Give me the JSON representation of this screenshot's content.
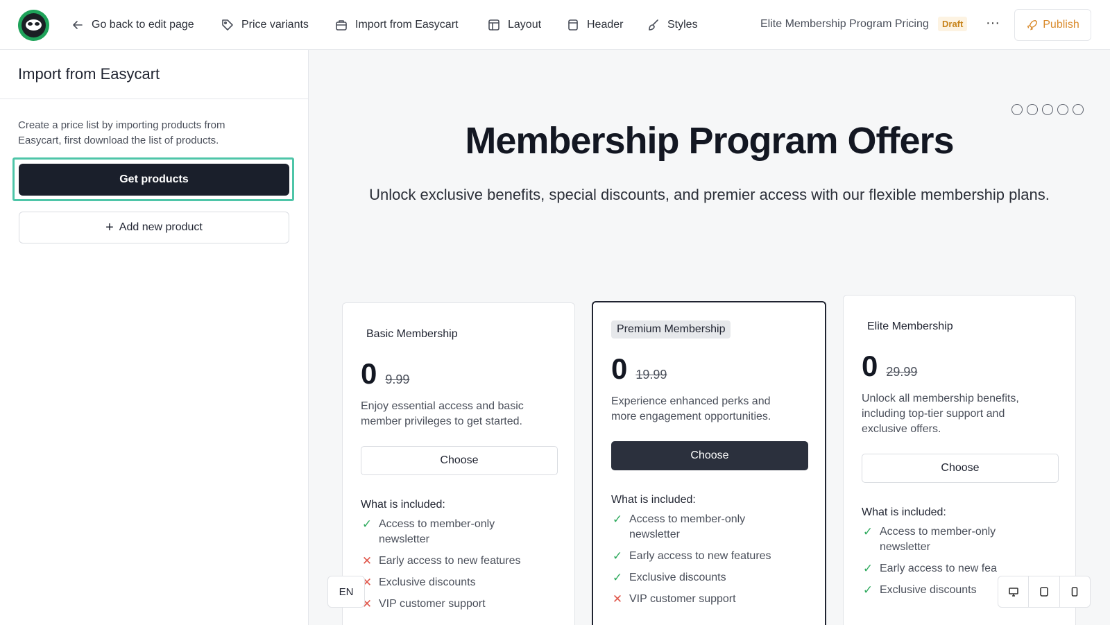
{
  "topbar": {
    "back_label": "Go back to edit page",
    "nav": [
      {
        "label": "Price variants",
        "icon": "tag-icon"
      },
      {
        "label": "Import from Easycart",
        "icon": "cart-icon"
      },
      {
        "label": "Layout",
        "icon": "layout-icon"
      },
      {
        "label": "Header",
        "icon": "header-icon"
      },
      {
        "label": "Styles",
        "icon": "brush-icon"
      }
    ],
    "doc_title": "Elite Membership Program Pricing",
    "status": "Draft",
    "more": "···",
    "publish_label": "Publish"
  },
  "sidebar": {
    "title": "Import from Easycart",
    "description": "Create a price list by importing products from Easycart, first download the list of products.",
    "get_products_label": "Get products",
    "add_product_label": "Add new product"
  },
  "page": {
    "title": "Membership Program Offers",
    "subtitle": "Unlock exclusive benefits, special discounts, and premier access with our flexible membership plans."
  },
  "plans": [
    {
      "name": "Basic Membership",
      "price": "0",
      "old_price": "9.99",
      "description": "Enjoy essential access and basic member privileges to get started.",
      "cta": "Choose",
      "included_label": "What is included:",
      "features": [
        {
          "text": "Access to member-only newsletter",
          "included": true
        },
        {
          "text": "Early access to new features",
          "included": false
        },
        {
          "text": "Exclusive discounts",
          "included": false
        },
        {
          "text": "VIP customer support",
          "included": false
        }
      ]
    },
    {
      "name": "Premium Membership",
      "price": "0",
      "old_price": "19.99",
      "description": "Experience enhanced perks and more engagement opportunities.",
      "cta": "Choose",
      "included_label": "What is included:",
      "features": [
        {
          "text": "Access to member-only newsletter",
          "included": true
        },
        {
          "text": "Early access to new features",
          "included": true
        },
        {
          "text": "Exclusive discounts",
          "included": true
        },
        {
          "text": "VIP customer support",
          "included": false
        }
      ]
    },
    {
      "name": "Elite Membership",
      "price": "0",
      "old_price": "29.99",
      "description": "Unlock all membership benefits, including top-tier support and exclusive offers.",
      "cta": "Choose",
      "included_label": "What is included:",
      "features": [
        {
          "text": "Access to member-only newsletter",
          "included": true
        },
        {
          "text": "Early access to new fea",
          "included": true
        },
        {
          "text": "Exclusive discounts",
          "included": true
        }
      ]
    }
  ],
  "language": "EN",
  "colors": {
    "accent": "#4ec5a8",
    "dark": "#1a1f2b",
    "publish": "#d98a2b",
    "check": "#2eaa5d",
    "cross": "#e0564a"
  }
}
